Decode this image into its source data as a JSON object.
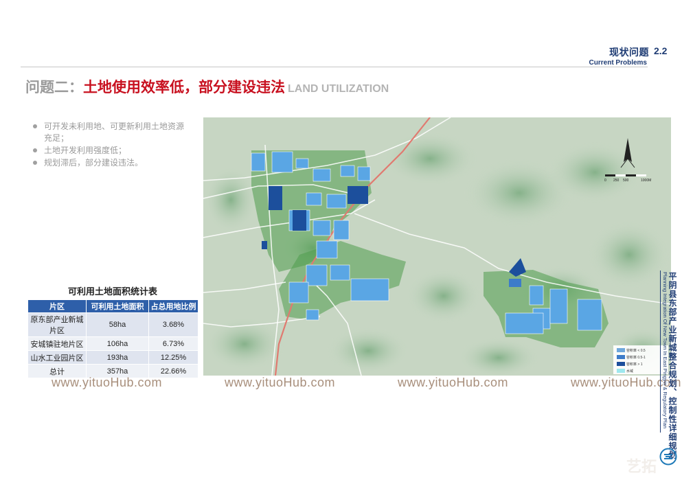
{
  "header": {
    "section_title": "现状问题",
    "section_number": "2.2",
    "section_subtitle": "Current Problems"
  },
  "title": {
    "prefix": "问题二：",
    "main": "土地使用效率低，部分建设违法",
    "english": "LAND UTILIZATION"
  },
  "bullets": [
    "可开发未利用地、可更新利用土地资源充足；",
    "土地开发利用强度低；",
    "规划滞后，部分建设违法。"
  ],
  "table": {
    "title": "可利用土地面积统计表",
    "headers": [
      "片区",
      "可利用土地面积",
      "占总用地比例"
    ],
    "rows": [
      [
        "原东部产业新城片区",
        "58ha",
        "3.68%"
      ],
      [
        "安城镇驻地片区",
        "106ha",
        "6.73%"
      ],
      [
        "山水工业园片区",
        "193ha",
        "12.25%"
      ],
      [
        "总计",
        "357ha",
        "22.66%"
      ]
    ]
  },
  "map": {
    "scale_labels": [
      "0",
      "250",
      "500",
      "1000M"
    ],
    "legend": [
      {
        "label": "容积率 < 0.5",
        "color": "#6fa8dc"
      },
      {
        "label": "容积率 0.5-1",
        "color": "#3d7cc9"
      },
      {
        "label": "容积率 > 1",
        "color": "#1c4f9c"
      },
      {
        "label": "水域",
        "color": "#9ee8ee"
      }
    ]
  },
  "watermarks": [
    "www.yituoHub.com",
    "www.yituoHub.com",
    "www.yituoHub.com",
    "www.yituoHub.com"
  ],
  "side": {
    "title_zh": "平阴县东部产业新城整合规划、控制性详细规划",
    "title_en": "Planning Integration Of New Town In East Pingyin & Regulatory Plan"
  },
  "brand_text": "艺拓"
}
